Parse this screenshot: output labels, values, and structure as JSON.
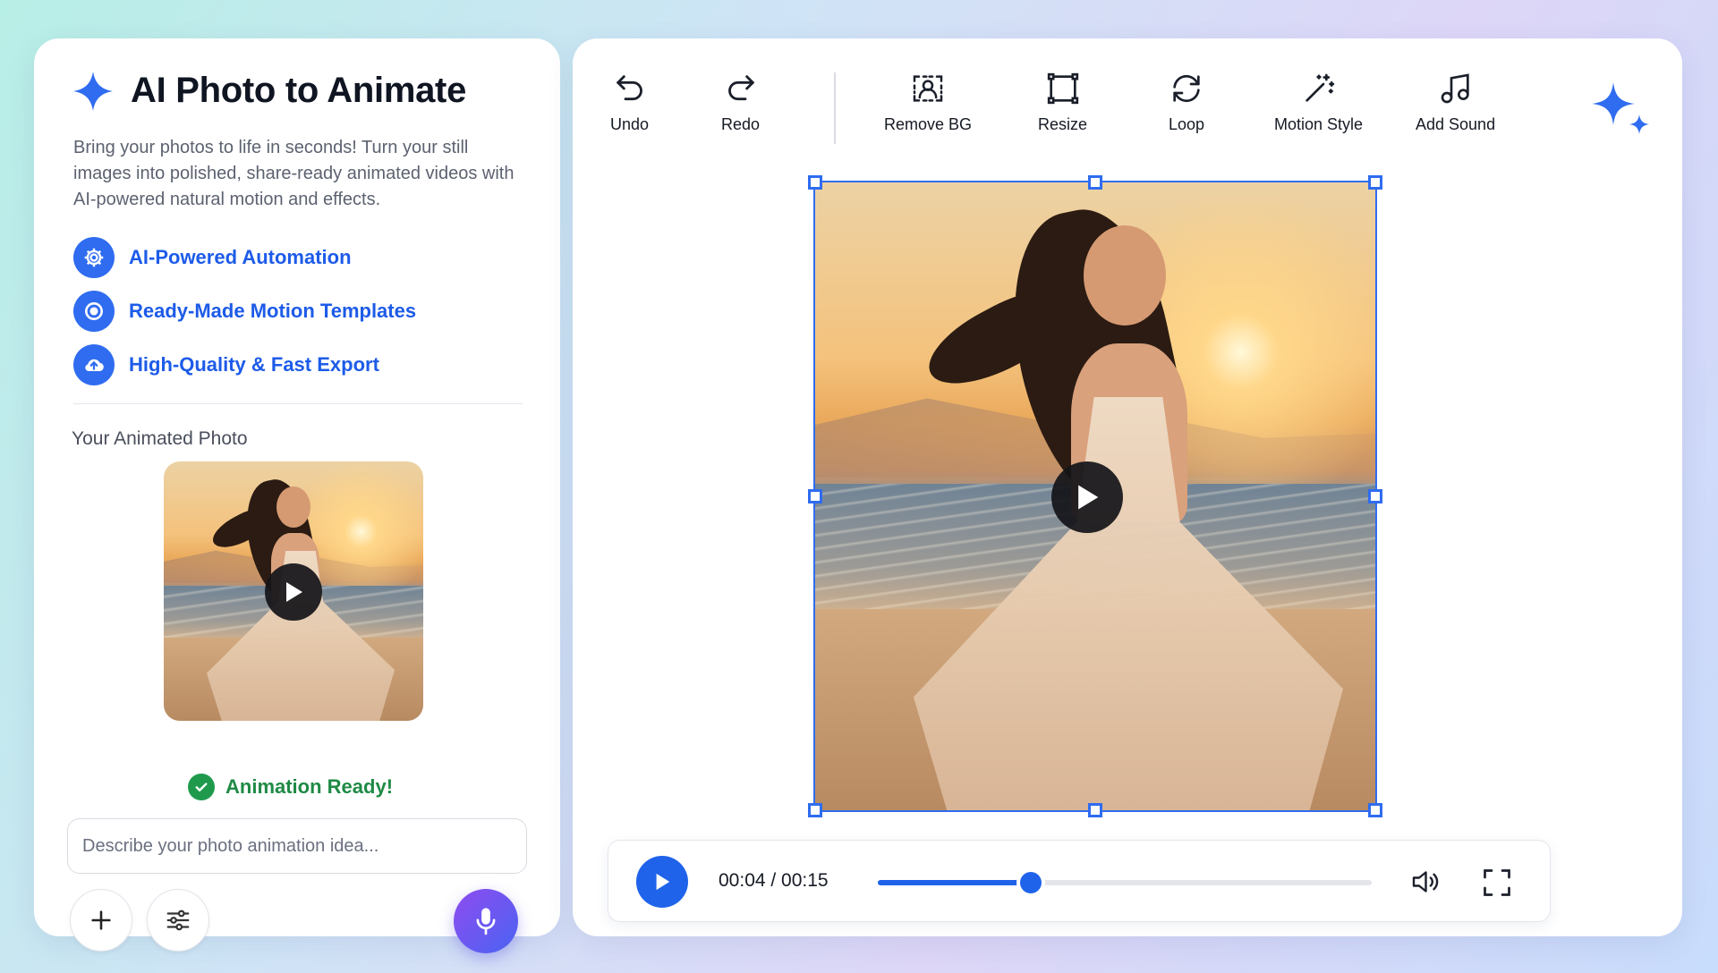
{
  "app": {
    "title": "AI Photo to Animate",
    "description": "Bring your photos to life in seconds! Turn your still images into polished, share-ready animated videos with AI-powered natural motion and effects."
  },
  "features": [
    {
      "label": "AI-Powered Automation",
      "icon": "gear-icon"
    },
    {
      "label": "Ready-Made Motion Templates",
      "icon": "target-icon"
    },
    {
      "label": "High-Quality & Fast Export",
      "icon": "cloud-upload-icon"
    }
  ],
  "preview": {
    "section_title": "Your Animated Photo",
    "status": "Animation Ready!"
  },
  "prompt": {
    "placeholder": "Describe your photo animation idea..."
  },
  "toolbar": [
    {
      "label": "Undo",
      "icon": "undo-icon"
    },
    {
      "label": "Redo",
      "icon": "redo-icon"
    },
    {
      "label": "Remove BG",
      "icon": "remove-bg-icon"
    },
    {
      "label": "Resize",
      "icon": "resize-icon"
    },
    {
      "label": "Loop",
      "icon": "loop-icon"
    },
    {
      "label": "Motion Style",
      "icon": "magic-wand-icon"
    },
    {
      "label": "Add Sound",
      "icon": "music-note-icon"
    }
  ],
  "player": {
    "time": "00:04 / 00:15",
    "progress": 0.31
  },
  "colors": {
    "accent": "#2f6cf0",
    "success": "#1f8a45",
    "mic_gradient_start": "#8f4cf0",
    "mic_gradient_end": "#4a63f2"
  }
}
